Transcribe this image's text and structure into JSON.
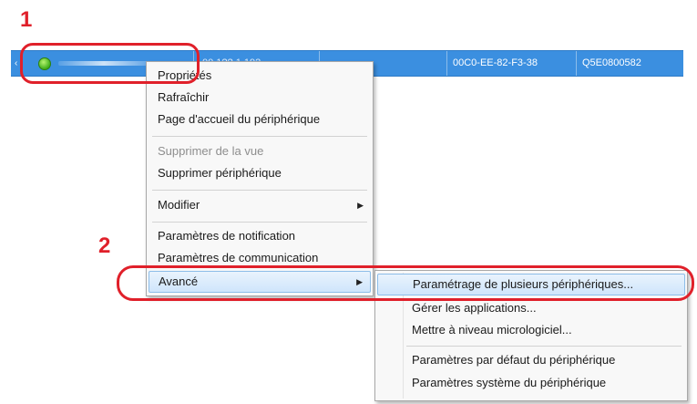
{
  "callouts": {
    "step1": "1",
    "step2": "2"
  },
  "device_row": {
    "mark": "‹",
    "ip": "00.1?? 1.192",
    "mac": "00C0-EE-82-F3-38",
    "serial": "Q5E0800582",
    "status_color": "#3fae1a",
    "selection_color": "#3b8fe0"
  },
  "context_menu": {
    "items": [
      {
        "label": "Propriétés"
      },
      {
        "label": "Rafraîchir"
      },
      {
        "label": "Page d'accueil du périphérique"
      },
      {
        "label": "Supprimer de la vue",
        "disabled": true
      },
      {
        "label": "Supprimer périphérique"
      },
      {
        "label": "Modifier",
        "submenu": true
      },
      {
        "label": "Paramètres de notification"
      },
      {
        "label": "Paramètres de communication"
      },
      {
        "label": "Avancé",
        "submenu": true,
        "highlighted": true
      }
    ],
    "submenu_arrow": "▶"
  },
  "advanced_submenu": {
    "items": [
      {
        "label": "Paramétrage de plusieurs périphériques...",
        "highlighted": true
      },
      {
        "label": "Gérer les applications..."
      },
      {
        "label": "Mettre à niveau micrologiciel..."
      },
      {
        "label": "Paramètres par défaut du périphérique"
      },
      {
        "label": "Paramètres système du périphérique"
      }
    ]
  },
  "highlight_color": "#e0202a"
}
